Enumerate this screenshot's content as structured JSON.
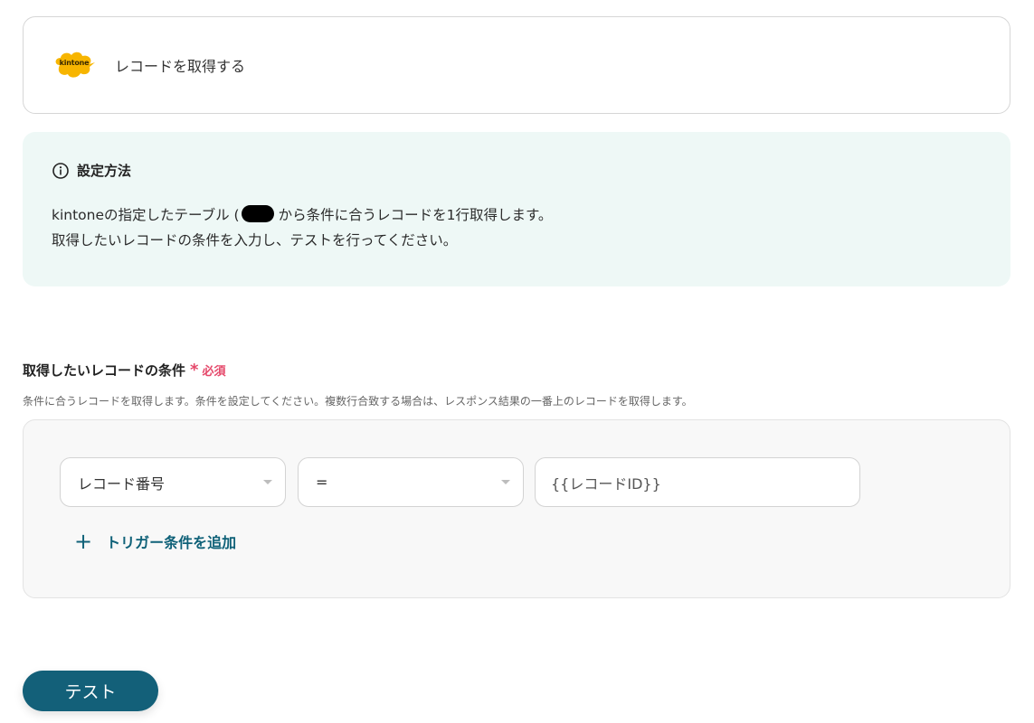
{
  "app_card": {
    "logo_text": "kintone",
    "action_title": "レコードを取得する"
  },
  "info": {
    "heading": "設定方法",
    "line1_before": "kintoneの指定したテーブル",
    "line1_paren": "(",
    "line1_after": "から条件に合うレコードを1行取得します。",
    "line2": "取得したいレコードの条件を入力し、テストを行ってください。"
  },
  "condition_field": {
    "label": "取得したいレコードの条件",
    "required_star": "*",
    "required_text": "必須",
    "help": "条件に合うレコードを取得します。条件を設定してください。複数行合致する場合は、レスポンス結果の一番上のレコードを取得します。",
    "field_select": "レコード番号",
    "operator_select": "=",
    "value": "{{レコードID}}",
    "add_condition_icon": "+",
    "add_condition_label": "トリガー条件を追加"
  },
  "test_button_label": "テスト",
  "colors": {
    "accent": "#136079",
    "link": "#0f6178",
    "required": "#e5486a",
    "info_bg": "#eef8f6",
    "logo": "#f7b500"
  },
  "icons": {
    "info": "info-circle-icon",
    "logo": "kintone-logo",
    "caret": "caret-down-icon",
    "plus": "plus-icon"
  }
}
